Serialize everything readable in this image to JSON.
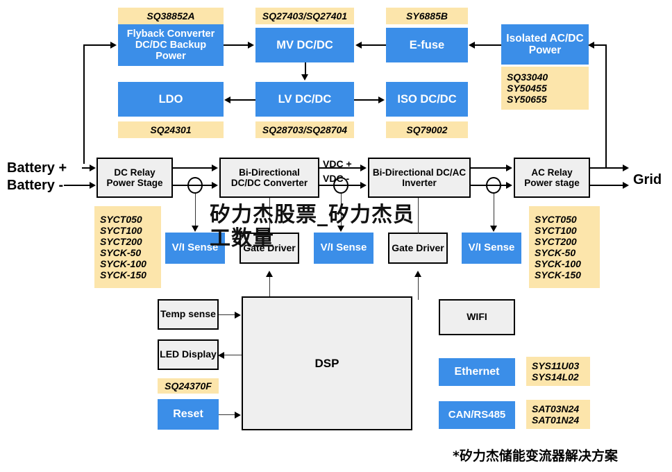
{
  "diagram": {
    "title_footer": "*矽力杰储能变流器解决方案",
    "watermark_line1": "矽力杰股票_矽力杰员",
    "watermark_line2": "工数量",
    "colors": {
      "block_blue": "#3b8ee8",
      "block_gray": "#efefef",
      "part_tag_yellow": "#fce5ab",
      "line_black": "#000000"
    }
  },
  "power_row1": {
    "flyback": {
      "label": "Flyback Converter DC/DC Backup Power",
      "part": "SQ38852A"
    },
    "mv_dcdc": {
      "label": "MV DC/DC",
      "part": "SQ27403/SQ27401"
    },
    "efuse": {
      "label": "E-fuse",
      "part": "SY6885B"
    },
    "isolated_acdc": {
      "label": "Isolated AC/DC Power",
      "part": "SQ33040\nSY50455\nSY50655"
    }
  },
  "power_row2": {
    "ldo": {
      "label": "LDO",
      "part": "SQ24301"
    },
    "lv_dcdc": {
      "label": "LV DC/DC",
      "part": "SQ28703/SQ28704"
    },
    "iso_dcdc": {
      "label": "ISO DC/DC",
      "part": "SQ79002"
    }
  },
  "main_chain": {
    "battery_plus": "Battery +",
    "battery_minus": "Battery -",
    "dc_relay": "DC Relay Power Stage",
    "dcdc_converter": "Bi-Directional DC/DC Converter",
    "vdc_plus": "VDC +",
    "vdc_minus": "VDC -",
    "dcac_inverter": "Bi-Directional DC/AC Inverter",
    "ac_relay": "AC Relay Power stage",
    "grid": "Grid"
  },
  "sense_row": {
    "vi_sense_1": "V/I Sense",
    "gate_driver_1": "Gate Driver",
    "vi_sense_2": "V/I Sense",
    "gate_driver_2": "Gate Driver",
    "vi_sense_3": "V/I Sense",
    "left_parts": "SYCT050\nSYCT100\nSYCT200\nSYCK-50\nSYCK-100\nSYCK-150",
    "right_parts": "SYCT050\nSYCT100\nSYCT200\nSYCK-50\nSYCK-100\nSYCK-150"
  },
  "control": {
    "temp_sense": "Temp sense",
    "led_display": "LED Display",
    "reset": {
      "label": "Reset",
      "part": "SQ24370F"
    },
    "dsp": "DSP",
    "wifi": "WIFI",
    "ethernet": {
      "label": "Ethernet",
      "part": "SYS11U03\nSYS14L02"
    },
    "can_rs485": {
      "label": "CAN/RS485",
      "part": "SAT03N24\nSAT01N24"
    }
  }
}
